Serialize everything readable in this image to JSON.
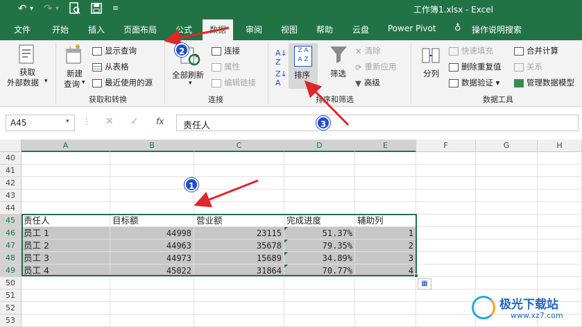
{
  "titlebar": {
    "title": "工作簿1.xlsx  -  Excel"
  },
  "tabs": [
    "文件",
    "开始",
    "插入",
    "页面布局",
    "公式",
    "数据",
    "审阅",
    "视图",
    "帮助",
    "云盘",
    "Power Pivot",
    "操作说明搜索"
  ],
  "ribbon": {
    "get_external_line1": "获取",
    "get_external_line2": "外部数据",
    "new_query_line1": "新建",
    "new_query_line2": "查询",
    "show_query": "显示查询",
    "from_table": "从表格",
    "recent_sources": "最近使用的源",
    "group_get_transform": "获取和转换",
    "refresh_all": "全部刷新",
    "connections": "连接",
    "properties": "属性",
    "edit_links": "编辑链接",
    "group_connections": "连接",
    "sort": "排序",
    "filter": "筛选",
    "clear": "清除",
    "reapply": "重新应用",
    "advanced": "高级",
    "group_sort_filter": "排序和筛选",
    "text_to_columns": "分列",
    "flash_fill": "快速填充",
    "remove_duplicates": "删除重复值",
    "data_validation": "数据验证",
    "consolidate": "合并计算",
    "relationships": "关系",
    "manage_data_model": "管理数据模型",
    "group_data_tools": "数据工具"
  },
  "formula_bar": {
    "name_box": "A45",
    "fx": "fx",
    "content": "责任人"
  },
  "columns": [
    "A",
    "B",
    "C",
    "D",
    "E",
    "F",
    "G",
    "H"
  ],
  "row_numbers": [
    "40",
    "41",
    "42",
    "43",
    "44",
    "45",
    "46",
    "47",
    "48",
    "49",
    "50",
    "51",
    "52",
    "53"
  ],
  "table": {
    "headers": [
      "责任人",
      "目标额",
      "营业额",
      "完成进度",
      "辅助列"
    ],
    "rows": [
      [
        "员工 1",
        "44998",
        "23115",
        "51.37%",
        "1"
      ],
      [
        "员工 2",
        "44963",
        "35678",
        "79.35%",
        "2"
      ],
      [
        "员工 3",
        "44973",
        "15689",
        "34.89%",
        "3"
      ],
      [
        "员工 4",
        "45022",
        "31864",
        "70.77%",
        "4"
      ]
    ]
  },
  "annotations": {
    "badge1": "1",
    "badge2": "2",
    "badge3": "3"
  },
  "watermark": {
    "brand": "极光下载站",
    "url": "www.xz7.com"
  },
  "colors": {
    "excel_green": "#217346",
    "badge_blue": "#1f4ec9",
    "arrow_red": "#e0262b",
    "selection_gray": "#c7c7c7"
  }
}
